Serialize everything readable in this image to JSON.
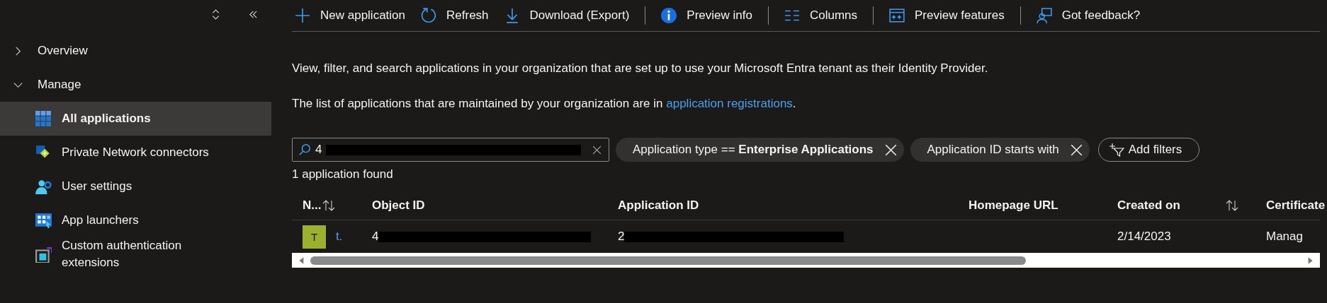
{
  "sidebar": {
    "groups": [
      {
        "label": "Overview",
        "expanded": false
      },
      {
        "label": "Manage",
        "expanded": true,
        "children": [
          {
            "label": "All applications",
            "kind": "grid",
            "selected": true
          },
          {
            "label": "Private Network connectors",
            "kind": "network",
            "selected": false
          },
          {
            "label": "User settings",
            "kind": "usergear",
            "selected": false
          },
          {
            "label": "App launchers",
            "kind": "launcher",
            "selected": false
          },
          {
            "label": "Custom authentication extensions",
            "kind": "extension",
            "selected": false
          }
        ]
      }
    ]
  },
  "toolbar": [
    {
      "label": "New application",
      "kind": "plus",
      "separator_before": false
    },
    {
      "label": "Refresh",
      "kind": "refresh",
      "separator_before": false
    },
    {
      "label": "Download (Export)",
      "kind": "download",
      "separator_before": false
    },
    {
      "label": "Preview info",
      "kind": "info",
      "separator_before": true
    },
    {
      "label": "Columns",
      "kind": "columns",
      "separator_before": true
    },
    {
      "label": "Preview features",
      "kind": "preview",
      "separator_before": true
    },
    {
      "label": "Got feedback?",
      "kind": "feedback",
      "separator_before": true
    }
  ],
  "description": "View, filter, and search applications in your organization that are set up to use your Microsoft Entra tenant as their Identity Provider.",
  "registrations_note": {
    "text": "The list of applications that are maintained by your organization are in ",
    "link": "application registrations",
    "after": "."
  },
  "search": {
    "value": "4",
    "redacted": true
  },
  "filters": [
    {
      "label": "Application type == **Enterprise Applications**"
    },
    {
      "label": "Application ID starts with"
    }
  ],
  "add_filters": "Add filters",
  "result_count": "1 application found",
  "table": {
    "columns": [
      {
        "label": "N...",
        "sortable": true
      },
      {
        "label": "Object ID",
        "sortable": false
      },
      {
        "label": "Application ID",
        "sortable": false
      },
      {
        "label": "Homepage URL",
        "sortable": false
      },
      {
        "label": "Created on",
        "sortable": true
      },
      {
        "label": "Certificate"
      }
    ],
    "rows": [
      {
        "avatar": "T",
        "color": "#9bb02e",
        "name": "t.",
        "object_id": {
          "text": "4",
          "redacted": true
        },
        "application_id": {
          "text": "2",
          "redacted": true
        },
        "created_on": "2/14/2023",
        "certificate": "Manag"
      }
    ]
  }
}
